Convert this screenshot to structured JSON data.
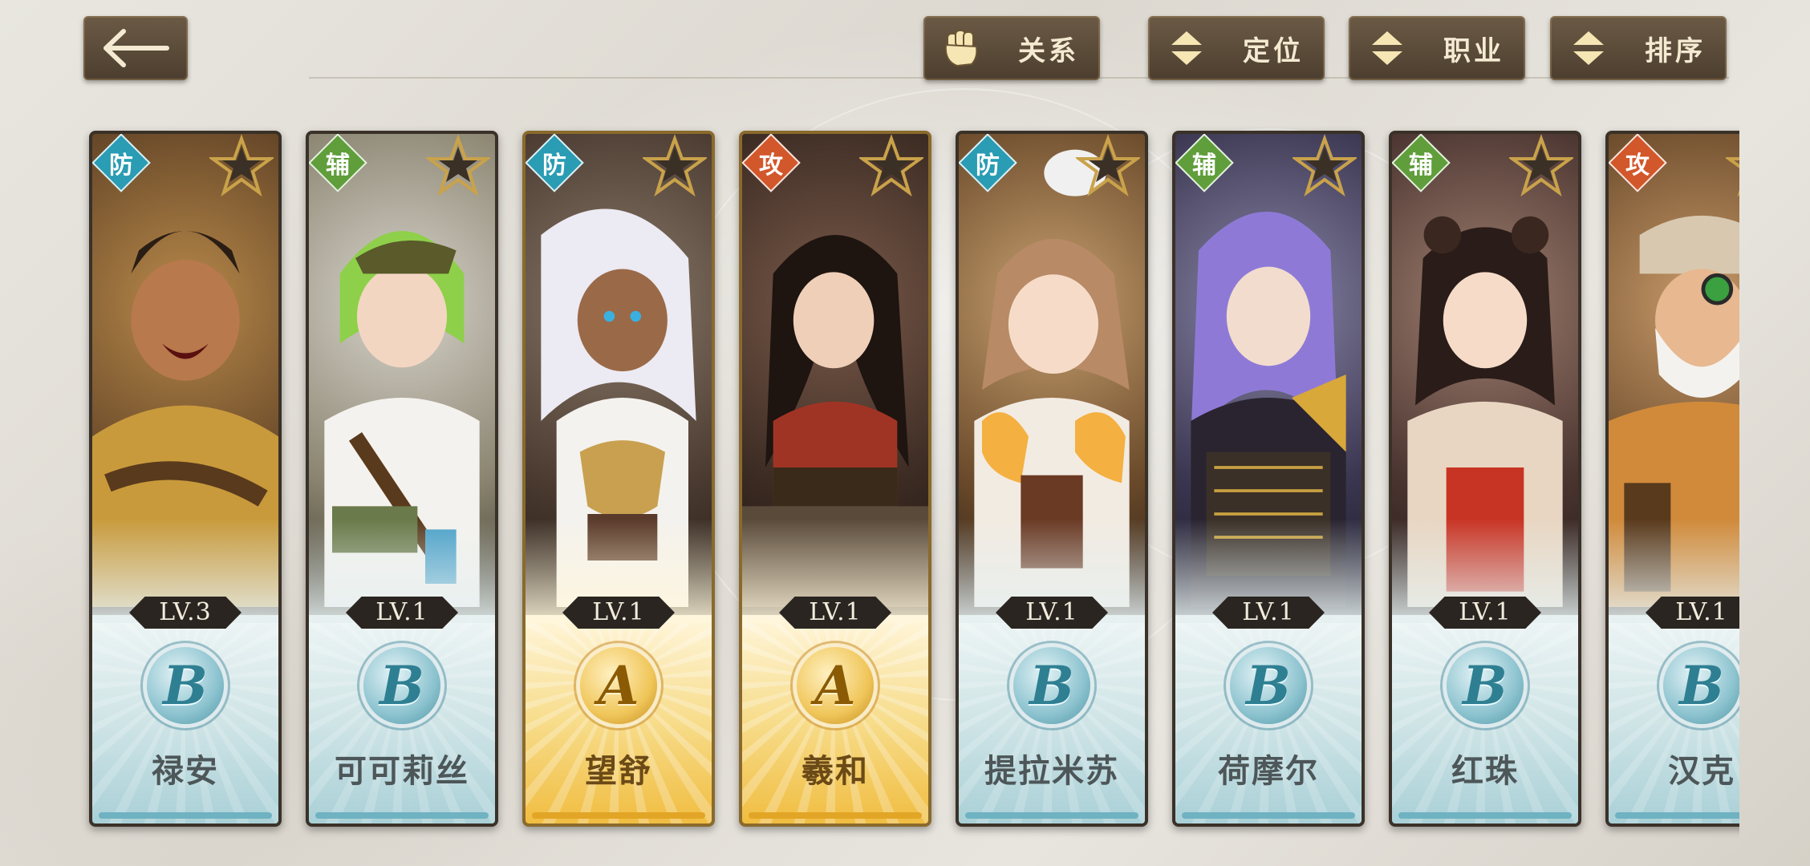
{
  "nav": {
    "back_icon": "arrow-left-icon"
  },
  "filters": [
    {
      "label": "关系",
      "icon": "fist-icon"
    },
    {
      "label": "定位",
      "icon": "sort-arrows-icon"
    },
    {
      "label": "职业",
      "icon": "sort-arrows-icon"
    },
    {
      "label": "排序",
      "icon": "sort-arrows-icon"
    }
  ],
  "colors": {
    "defense": "#2a9cb3",
    "support": "#5f9e3a",
    "attack": "#d2572a",
    "button_bg": "#5a4a38",
    "button_text": "#f4ead2"
  },
  "cards": [
    {
      "role": "防",
      "level": "LV.3",
      "rank": "B",
      "name": "禄安",
      "stars": 1
    },
    {
      "role": "辅",
      "level": "LV.1",
      "rank": "B",
      "name": "可可莉丝",
      "stars": 1
    },
    {
      "role": "防",
      "level": "LV.1",
      "rank": "A",
      "name": "望舒",
      "stars": 1
    },
    {
      "role": "攻",
      "level": "LV.1",
      "rank": "A",
      "name": "羲和",
      "stars": 1
    },
    {
      "role": "防",
      "level": "LV.1",
      "rank": "B",
      "name": "提拉米苏",
      "stars": 1
    },
    {
      "role": "辅",
      "level": "LV.1",
      "rank": "B",
      "name": "荷摩尔",
      "stars": 1
    },
    {
      "role": "辅",
      "level": "LV.1",
      "rank": "B",
      "name": "红珠",
      "stars": 1
    },
    {
      "role": "攻",
      "level": "LV.1",
      "rank": "B",
      "name": "汉克",
      "stars": 1
    }
  ]
}
